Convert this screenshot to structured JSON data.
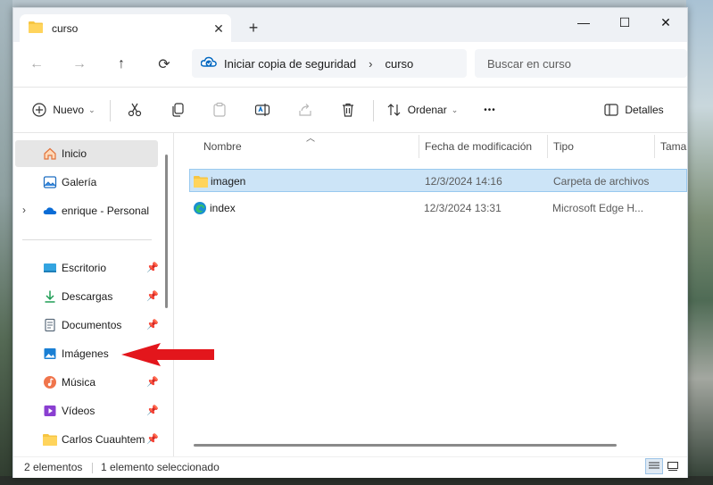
{
  "window": {
    "tab_title": "curso",
    "tab_close": "✕",
    "new_tab": "+",
    "controls": {
      "minimize": "—",
      "maximize": "☐",
      "close": "✕"
    }
  },
  "address": {
    "back": "←",
    "forward": "→",
    "up": "↑",
    "refresh": "⟳",
    "segments": [
      "Iniciar copia de seguridad",
      "curso"
    ],
    "chevron": "›",
    "search_placeholder": "Buscar en curso"
  },
  "toolbar": {
    "new_label": "Nuevo",
    "sort_label": "Ordenar",
    "more_label": "•••",
    "details_label": "Detalles",
    "icons": [
      "cut-icon",
      "copy-icon",
      "paste-icon",
      "rename-icon",
      "share-icon",
      "delete-icon"
    ]
  },
  "sidebar": {
    "items": [
      {
        "label": "Inicio",
        "icon": "home-icon"
      },
      {
        "label": "Galería",
        "icon": "gallery-icon"
      },
      {
        "label": "enrique - Personal",
        "icon": "onedrive-icon"
      },
      {
        "label": "Escritorio",
        "icon": "desktop-icon"
      },
      {
        "label": "Descargas",
        "icon": "download-icon"
      },
      {
        "label": "Documentos",
        "icon": "documents-icon"
      },
      {
        "label": "Imágenes",
        "icon": "pictures-icon"
      },
      {
        "label": "Música",
        "icon": "music-icon"
      },
      {
        "label": "Vídeos",
        "icon": "videos-icon"
      },
      {
        "label": "Carlos Cuauhtem",
        "icon": "folder-icon"
      }
    ]
  },
  "filelist": {
    "columns": [
      "Nombre",
      "Fecha de modificación",
      "Tipo",
      "Tama"
    ],
    "rows": [
      {
        "name": "imagen",
        "date": "12/3/2024 14:16",
        "type": "Carpeta de archivos",
        "icon": "folder-icon"
      },
      {
        "name": "index",
        "date": "12/3/2024 13:31",
        "type": "Microsoft Edge H...",
        "icon": "edge-icon"
      }
    ]
  },
  "status": {
    "count": "2 elementos",
    "selected": "1 elemento seleccionado"
  },
  "colors": {
    "accent": "#0067c0",
    "selection": "#cce4f7",
    "annotation_red": "#e3161c",
    "folder": "#f6c542"
  }
}
